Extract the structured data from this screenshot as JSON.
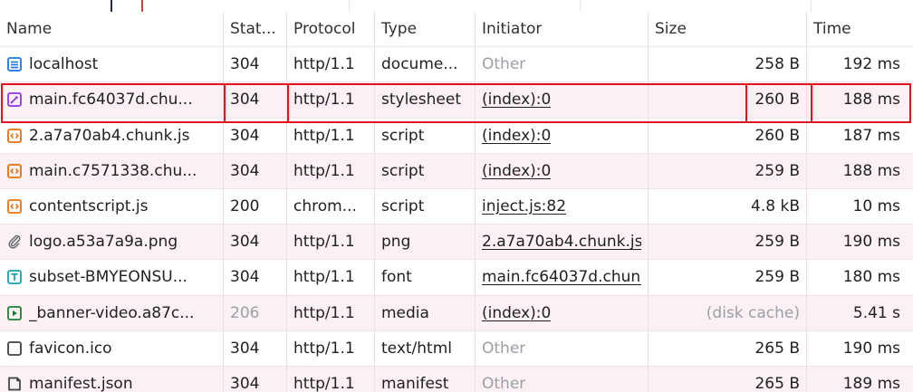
{
  "columns": {
    "name": "Name",
    "status": "Stat...",
    "protocol": "Protocol",
    "type": "Type",
    "initiator": "Initiator",
    "size": "Size",
    "time": "Time"
  },
  "rows": [
    {
      "icon": "document-icon",
      "name": "localhost",
      "status": "304",
      "protocol": "http/1.1",
      "type": "docume...",
      "initiator": "Other",
      "size": "258 B",
      "time": "192 ms"
    },
    {
      "icon": "stylesheet-icon",
      "name": "main.fc64037d.chu...",
      "status": "304",
      "protocol": "http/1.1",
      "type": "stylesheet",
      "initiator": "(index):0",
      "size": "260 B",
      "time": "188 ms"
    },
    {
      "icon": "script-icon",
      "name": "2.a7a70ab4.chunk.js",
      "status": "304",
      "protocol": "http/1.1",
      "type": "script",
      "initiator": "(index):0",
      "size": "260 B",
      "time": "187 ms"
    },
    {
      "icon": "script-icon",
      "name": "main.c7571338.chu...",
      "status": "304",
      "protocol": "http/1.1",
      "type": "script",
      "initiator": "(index):0",
      "size": "259 B",
      "time": "188 ms"
    },
    {
      "icon": "script-icon",
      "name": "contentscript.js",
      "status": "200",
      "protocol": "chrom...",
      "type": "script",
      "initiator": "inject.js:82",
      "size": "4.8 kB",
      "time": "10 ms"
    },
    {
      "icon": "image-icon",
      "name": "logo.a53a7a9a.png",
      "status": "304",
      "protocol": "http/1.1",
      "type": "png",
      "initiator": "2.a7a70ab4.chunk.js",
      "size": "259 B",
      "time": "190 ms"
    },
    {
      "icon": "font-icon",
      "name": "subset-BMYEONSU...",
      "status": "304",
      "protocol": "http/1.1",
      "type": "font",
      "initiator": "main.fc64037d.chunk",
      "size": "259 B",
      "time": "180 ms"
    },
    {
      "icon": "media-icon",
      "name": "_banner-video.a87c...",
      "status": "206",
      "protocol": "http/1.1",
      "type": "media",
      "initiator": "(index):0",
      "size": "(disk cache)",
      "time": "5.41 s"
    },
    {
      "icon": "favicon-icon",
      "name": "favicon.ico",
      "status": "304",
      "protocol": "http/1.1",
      "type": "text/html",
      "initiator": "Other",
      "size": "265 B",
      "time": "190 ms"
    },
    {
      "icon": "manifest-icon",
      "name": "manifest.json",
      "status": "304",
      "protocol": "http/1.1",
      "type": "manifest",
      "initiator": "Other",
      "size": "265 B",
      "time": "189 ms"
    }
  ],
  "styles": {
    "document_icon_color": "#1a73e8",
    "stylesheet_icon_color": "#9334e6",
    "script_icon_color": "#e8710a",
    "font_icon_color": "#12a4af",
    "media_icon_color": "#188038",
    "highlight_color": "#e0131f",
    "row_alt_background": "#fbf0f4"
  }
}
